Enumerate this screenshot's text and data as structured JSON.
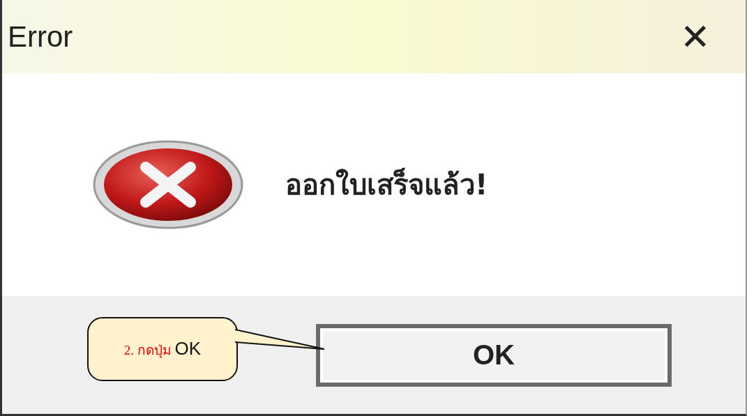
{
  "window": {
    "title": "Error",
    "close": "✕"
  },
  "message": {
    "text": "ออกใบเสร็จแล้ว!"
  },
  "buttons": [
    {
      "label": "OK"
    }
  ],
  "callout": {
    "step": "2. กดปุ่ม",
    "target": "OK"
  }
}
